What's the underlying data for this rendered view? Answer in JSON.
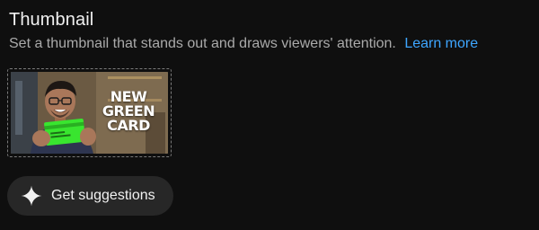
{
  "section": {
    "title": "Thumbnail",
    "description": "Set a thumbnail that stands out and draws viewers' attention.",
    "learn_more": "Learn more"
  },
  "thumbnail": {
    "overlay_lines": [
      "NEW",
      "GREEN",
      "CARD"
    ],
    "card_color": "#39e52f"
  },
  "suggest": {
    "label": "Get suggestions",
    "icon": "sparkle-icon"
  },
  "colors": {
    "background": "#0f0f0f",
    "link": "#3ea6ff",
    "button_bg": "#272727"
  }
}
